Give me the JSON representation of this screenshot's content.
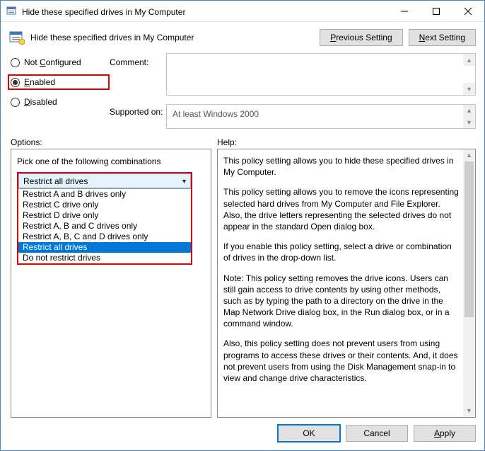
{
  "window": {
    "title": "Hide these specified drives in My Computer"
  },
  "header": {
    "title": "Hide these specified drives in My Computer",
    "prev": "Previous Setting",
    "next": "Next Setting"
  },
  "state": {
    "not_configured": "Not Configured",
    "enabled": "Enabled",
    "disabled": "Disabled",
    "selected": "enabled"
  },
  "labels": {
    "comment": "Comment:",
    "supported": "Supported on:",
    "options": "Options:",
    "help": "Help:"
  },
  "supported_text": "At least Windows 2000",
  "options": {
    "caption": "Pick one of the following combinations",
    "selected": "Restrict all drives",
    "items": [
      "Restrict A and B drives only",
      "Restrict C drive only",
      "Restrict D drive only",
      "Restrict A, B and C drives only",
      "Restrict A, B, C and D drives only",
      "Restrict all drives",
      "Do not restrict drives"
    ]
  },
  "help": {
    "p1": "This policy setting allows you to hide these specified drives in My Computer.",
    "p2": "This policy setting allows you to remove the icons representing selected hard drives from My Computer and File Explorer. Also, the drive letters representing the selected drives do not appear in the standard Open dialog box.",
    "p3": "If you enable this policy setting, select a drive or combination of drives in the drop-down list.",
    "p4": "Note: This policy setting removes the drive icons. Users can still gain access to drive contents by using other methods, such as by typing the path to a directory on the drive in the Map Network Drive dialog box, in the Run dialog box, or in a command window.",
    "p5": "Also, this policy setting does not prevent users from using programs to access these drives or their contents. And, it does not prevent users from using the Disk Management snap-in to view and change drive characteristics."
  },
  "buttons": {
    "ok": "OK",
    "cancel": "Cancel",
    "apply": "Apply"
  }
}
